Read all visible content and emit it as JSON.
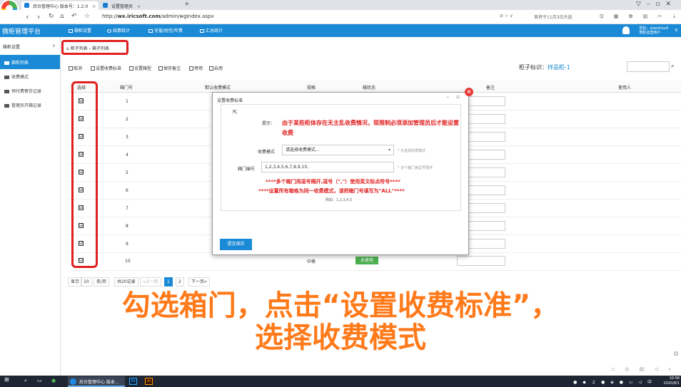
{
  "browser": {
    "tabs": [
      {
        "label": "后台管理中心 版本号：1.2.0",
        "active": true
      },
      {
        "label": "设置管理员",
        "active": false
      }
    ],
    "new_tab": "+",
    "url_prefix": "http://",
    "url_domain": "wx.iricsoft.com",
    "url_path": "/admin/wgIndex.aspx",
    "search_hint": "美将于11月3日大选"
  },
  "app": {
    "brand": "微柜管理平台",
    "nav": [
      "箱柜设置",
      "结算统计",
      "充值/短信/年费",
      "汇总统计"
    ],
    "user_line1": "您好，xiaoshou4",
    "user_line2": "微柜运营用户"
  },
  "sidebar": {
    "header": "箱柜设置",
    "items": [
      {
        "label": "箱柜列表",
        "active": true
      },
      {
        "label": "收费模式",
        "active": false
      },
      {
        "label": "预付费寄存记录",
        "active": false
      },
      {
        "label": "管理员开箱记录",
        "active": false
      }
    ]
  },
  "breadcrumb": {
    "parent": "柜子列表",
    "sep": "›",
    "current": "箱子列表"
  },
  "toolbar": {
    "buttons": [
      "取消",
      "设置收费标准",
      "设置箱型",
      "保存备注",
      "停用",
      "启用"
    ],
    "cabinet_label": "柜子标识：",
    "cabinet_name": "样品柜-1"
  },
  "table": {
    "headers": [
      "选择",
      "箱门号",
      "默认收费模式",
      "规格",
      "箱状态",
      "备注",
      "使用人"
    ],
    "rows": [
      {
        "no": "1",
        "checked": true
      },
      {
        "no": "2",
        "checked": true
      },
      {
        "no": "3",
        "checked": true
      },
      {
        "no": "4",
        "checked": true
      },
      {
        "no": "5",
        "checked": true
      },
      {
        "no": "6",
        "checked": true
      },
      {
        "no": "7",
        "checked": true
      },
      {
        "no": "8",
        "checked": true
      },
      {
        "no": "9",
        "checked": true
      },
      {
        "no": "10",
        "checked": true
      }
    ],
    "last_row_spec": "中格",
    "last_row_status": "未使用",
    "check_mark": "☑"
  },
  "pagination": {
    "show": "显示",
    "page_size": "10",
    "per_page": "条/页",
    "total": "共20记录",
    "prev": "«上一页",
    "pages": [
      "1",
      "2"
    ],
    "current": "1",
    "next": "下一页»"
  },
  "dialog": {
    "title": "设置收费标准",
    "tip_label": "提示：",
    "tip_text": "由于某些柜体存在无主乱收费情况，现限制必须添加管理员后才能设置收费",
    "mode_label": "收费模式",
    "mode_placeholder": "请选择收费模式...",
    "mode_hint": "* 先选择收费模式",
    "doors_label": "箱门编号",
    "doors_value": "1,2,3,4,5,6,7,8,9,10,",
    "doors_hint": "* 多个箱门用逗号隔开",
    "note1": "****多个箱门用逗号隔开,逗号（\",\"）使用英文标点符号****",
    "note2": "****设置所有箱格为同一收费模式，请把箱门号填写为\"ALL\"****",
    "example": "例如：1,2,3,4,5",
    "save_label": "提交保存"
  },
  "caption": {
    "line1": "勾选箱门，点击“设置收费标准”，",
    "line2": "选择收费模式"
  },
  "taskbar": {
    "app_label": "后台管理中心 版本...",
    "ps": "Ps",
    "ai": "Ai",
    "time": "10:58",
    "date": "2020/8/1"
  }
}
